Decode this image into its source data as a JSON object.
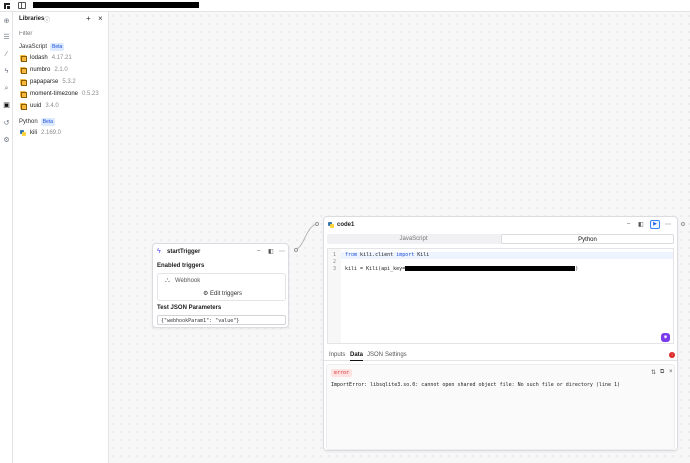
{
  "header": {
    "logo_icon": "app-logo-icon",
    "panel_icon": "sidebar-toggle-icon"
  },
  "rail": {
    "icons": [
      "plus-circle-icon",
      "list-icon",
      "sparkle-icon",
      "bolt-icon",
      "search-icon",
      "package-icon",
      "history-icon",
      "gear-icon"
    ]
  },
  "libraries": {
    "title": "Libraries",
    "filter_placeholder": "Filter",
    "js_section": "JavaScript",
    "beta_label": "Beta",
    "js_items": [
      {
        "name": "lodash",
        "version": "4.17.21"
      },
      {
        "name": "numbro",
        "version": "2.1.0"
      },
      {
        "name": "papaparse",
        "version": "5.3.2"
      },
      {
        "name": "moment-timezone",
        "version": "0.5.23"
      },
      {
        "name": "uuid",
        "version": "3.4.0"
      }
    ],
    "py_section": "Python",
    "py_items": [
      {
        "name": "kili",
        "version": "2.169.0"
      }
    ]
  },
  "trigger_node": {
    "name": "startTrigger",
    "enabled_label": "Enabled triggers",
    "webhook_label": "Webhook",
    "edit_label": "Edit triggers",
    "json_label": "Test JSON Parameters",
    "json_value": "{\"webhookParam1\": \"value\"}"
  },
  "code_node": {
    "name": "code1",
    "lang_js": "JavaScript",
    "lang_py": "Python",
    "selected_lang": "Python",
    "code_lines": [
      {
        "num": "1",
        "kw1": "from",
        "mid": " kili.client ",
        "kw2": "import",
        "end": " Kili"
      },
      {
        "num": "2",
        "text": ""
      },
      {
        "num": "3",
        "text": "kili = Kili(api_key="
      }
    ],
    "code_line3_tail": ")",
    "tabs": [
      "Inputs",
      "Data",
      "JSON",
      "Settings"
    ],
    "active_tab": "Data",
    "error_badge": "error",
    "error_message": "ImportError: libsqlite3.so.0: cannot open shared object file: No such file or directory (line 1)"
  },
  "colors": {
    "accent": "#4f46e5",
    "error": "#dc2626",
    "js_icon": "#f5b83d"
  }
}
